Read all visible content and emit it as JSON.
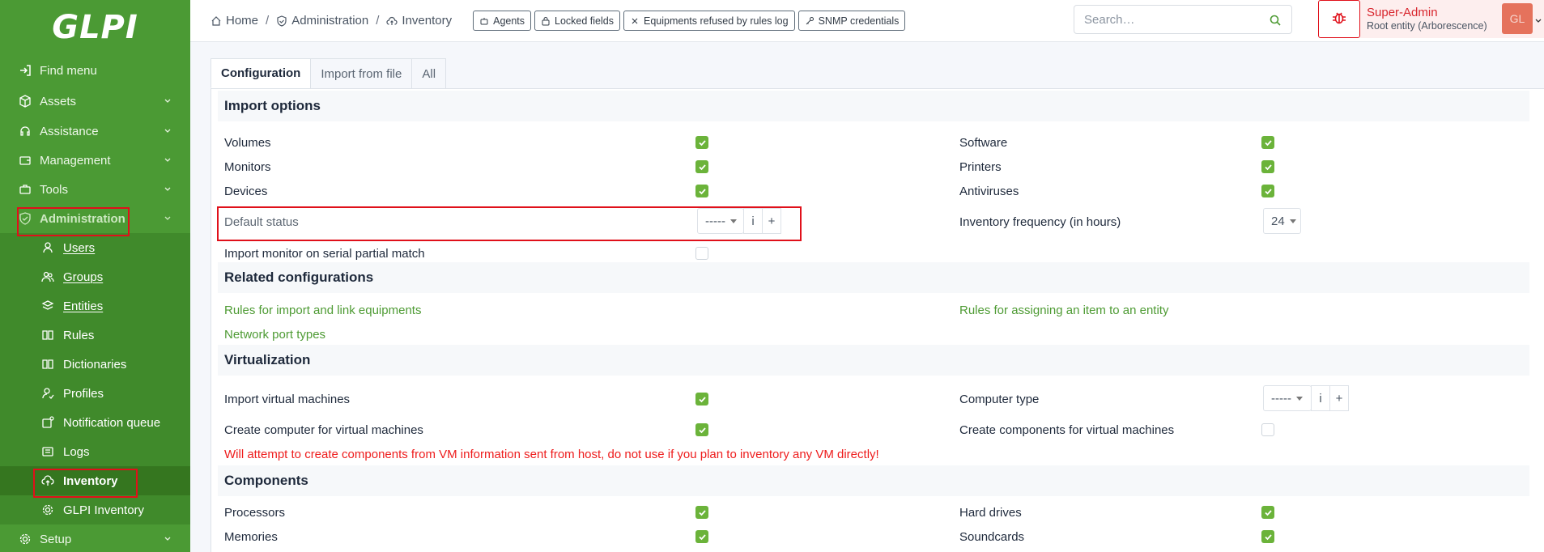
{
  "sidebar": {
    "logo": "GLPI",
    "items": [
      {
        "label": "Find menu"
      },
      {
        "label": "Assets"
      },
      {
        "label": "Assistance"
      },
      {
        "label": "Management"
      },
      {
        "label": "Tools"
      },
      {
        "label": "Administration"
      },
      {
        "label": "Setup"
      }
    ],
    "subitems": [
      {
        "label": "Users"
      },
      {
        "label": "Groups"
      },
      {
        "label": "Entities"
      },
      {
        "label": "Rules"
      },
      {
        "label": "Dictionaries"
      },
      {
        "label": "Profiles"
      },
      {
        "label": "Notification queue"
      },
      {
        "label": "Logs"
      },
      {
        "label": "Inventory"
      },
      {
        "label": "GLPI Inventory"
      }
    ]
  },
  "header": {
    "breadcrumb": [
      "Home",
      "Administration",
      "Inventory"
    ],
    "buttons": [
      "Agents",
      "Locked fields",
      "Equipments refused by rules log",
      "SNMP credentials"
    ],
    "search_placeholder": "Search…",
    "user_name": "Super-Admin",
    "user_entity": "Root entity (Arborescence)",
    "avatar_initials": "GL"
  },
  "tabs": [
    "Configuration",
    "Import from file",
    "All"
  ],
  "sections": {
    "import_options": "Import options",
    "related": "Related configurations",
    "virtualization": "Virtualization",
    "components": "Components"
  },
  "import_options": {
    "volumes": "Volumes",
    "software": "Software",
    "monitors": "Monitors",
    "printers": "Printers",
    "devices": "Devices",
    "antiviruses": "Antiviruses",
    "default_status": "Default status",
    "default_status_value": "-----",
    "inventory_frequency": "Inventory frequency (in hours)",
    "inventory_frequency_value": "24",
    "import_monitor_serial": "Import monitor on serial partial match",
    "checked": {
      "volumes": true,
      "software": true,
      "monitors": true,
      "printers": true,
      "devices": true,
      "antiviruses": true,
      "import_monitor_serial": false
    }
  },
  "related": {
    "rules_import": "Rules for import and link equipments",
    "rules_entity": "Rules for assigning an item to an entity",
    "network_port_types": "Network port types"
  },
  "virtualization": {
    "import_vm": "Import virtual machines",
    "computer_type": "Computer type",
    "computer_type_value": "-----",
    "create_computer_vm": "Create computer for virtual machines",
    "create_components_vm": "Create components for virtual machines",
    "warning": "Will attempt to create components from VM information sent from host, do not use if you plan to inventory any VM directly!",
    "checked": {
      "import_vm": true,
      "create_computer_vm": true,
      "create_components_vm": false
    }
  },
  "components": {
    "processors": "Processors",
    "hard_drives": "Hard drives",
    "memories": "Memories",
    "soundcards": "Soundcards",
    "checked": {
      "processors": true,
      "hard_drives": true,
      "memories": true,
      "soundcards": true
    }
  },
  "addon": {
    "info": "i",
    "add": "+"
  },
  "colors": {
    "sidebar": "#4b9a34",
    "link": "#4e9b34",
    "check": "#6bb33a",
    "warning": "#ee1c1c",
    "highlight": "#e0101a"
  }
}
